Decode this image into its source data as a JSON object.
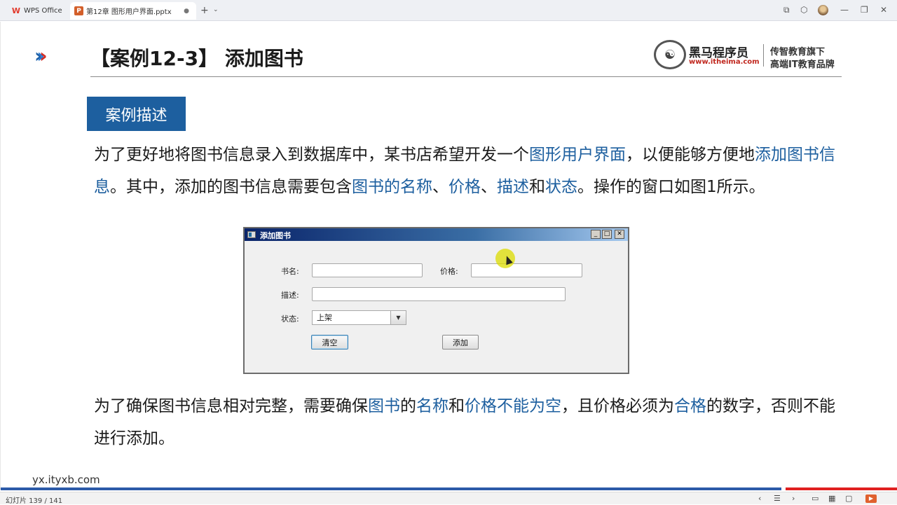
{
  "tabs": {
    "home_label": "WPS Office",
    "doc_label": "第12章 图形用户界面.pptx",
    "add_symbol": "+",
    "add_chevron": "⌄",
    "close_symbol": "●"
  },
  "window_controls": {
    "restore": "⧉",
    "cube": "⬡",
    "minimize": "—",
    "maximize": "❐",
    "close": "✕"
  },
  "slide": {
    "title": "【案例12-3】 添加图书",
    "brand": {
      "logo_glyph": "☯",
      "name": "黑马程序员",
      "url": "www.itheima.com",
      "slogan_line1": "传智教育旗下",
      "slogan_line2": "高端IT教育品牌"
    },
    "section_label": "案例描述",
    "para1": [
      {
        "t": "为了更好地将图书信息录入到数据库中，某书店希望开发一个",
        "hl": false
      },
      {
        "t": "图形用户界面",
        "hl": true
      },
      {
        "t": "，以便能够方便地",
        "hl": false
      },
      {
        "t": "添加图书信息",
        "hl": true
      },
      {
        "t": "。其中，添加的图书信息需要包含",
        "hl": false
      },
      {
        "t": "图书的名称",
        "hl": true
      },
      {
        "t": "、",
        "hl": false
      },
      {
        "t": "价格",
        "hl": true
      },
      {
        "t": "、",
        "hl": false
      },
      {
        "t": "描述",
        "hl": true
      },
      {
        "t": "和",
        "hl": false
      },
      {
        "t": "状态",
        "hl": true
      },
      {
        "t": "。操作的窗口如图1所示。",
        "hl": false
      }
    ],
    "para2": [
      {
        "t": "为了确保图书信息相对完整，需要确保",
        "hl": false
      },
      {
        "t": "图书",
        "hl": true
      },
      {
        "t": "的",
        "hl": false
      },
      {
        "t": "名称",
        "hl": true
      },
      {
        "t": "和",
        "hl": false
      },
      {
        "t": "价格不能为空",
        "hl": true
      },
      {
        "t": "，且价格必须为",
        "hl": false
      },
      {
        "t": "合格",
        "hl": true
      },
      {
        "t": "的数字，否则不能进行添加。",
        "hl": false
      }
    ],
    "watermark": "yx.ityxb.com"
  },
  "dialog": {
    "title": "添加图书",
    "min_btn": "_",
    "max_btn": "□",
    "close_btn": "✕",
    "name_label": "书名:",
    "name_value": "",
    "price_label": "价格:",
    "price_value": "",
    "desc_label": "描述:",
    "desc_value": "",
    "status_label": "状态:",
    "status_value": "上架",
    "dropdown_arrow": "▼",
    "clear_button": "清空",
    "add_button": "添加"
  },
  "statusbar": {
    "slide_counter": "幻灯片 139 / 141",
    "prev": "‹",
    "notes": "☰",
    "next": "›",
    "view_normal": "▭",
    "view_grid": "▦",
    "view_read": "▢",
    "play": "▶"
  },
  "colors": {
    "accent_blue": "#1d5f9f",
    "arrow_red": "#d22d25",
    "progress_blue": "#2c5aa8",
    "progress_red": "#e02020"
  },
  "slide_progress": 0.87
}
